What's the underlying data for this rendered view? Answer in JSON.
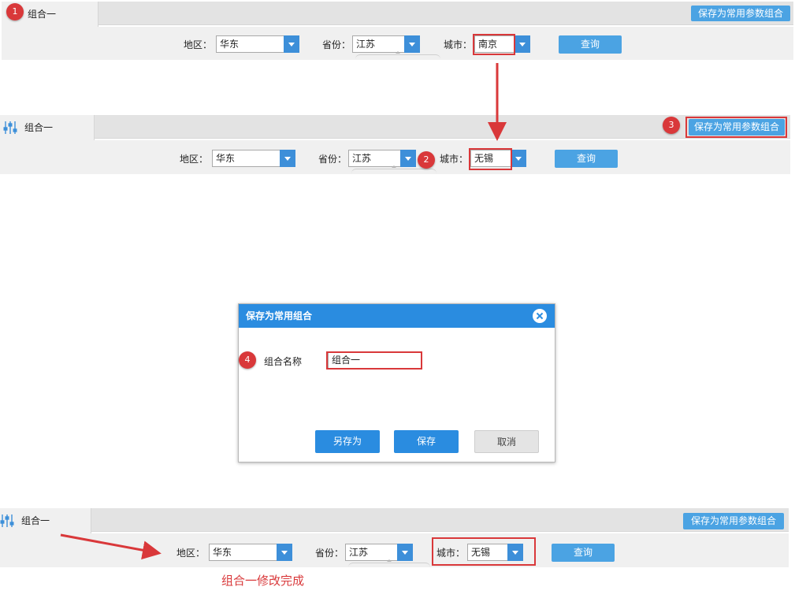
{
  "top_bar": {
    "tab_label": "组合一",
    "save_common_button": "保存为常用参数组合"
  },
  "filters": {
    "region_label": "地区：",
    "region_value": "华东",
    "province_label": "省份：",
    "province_value": "江苏",
    "city_label": "城市：",
    "query_button": "查询"
  },
  "panel1": {
    "city_value": "南京"
  },
  "panel2": {
    "city_value": "无锡"
  },
  "panel3": {
    "city_value": "无锡"
  },
  "badges": [
    "1",
    "2",
    "3",
    "4"
  ],
  "dialog": {
    "title": "保存为常用组合",
    "name_label": "组合名称",
    "name_value": "组合一",
    "save_as_button": "另存为",
    "save_button": "保存",
    "cancel_button": "取消"
  },
  "completion_message": "组合一修改完成",
  "colors": {
    "accent_blue": "#4ba3e3",
    "dialog_blue": "#2a8ce0",
    "annotation_red": "#d9383a"
  },
  "icons": [
    "settings-sliders-icon",
    "dropdown-arrow-icon",
    "close-icon"
  ]
}
